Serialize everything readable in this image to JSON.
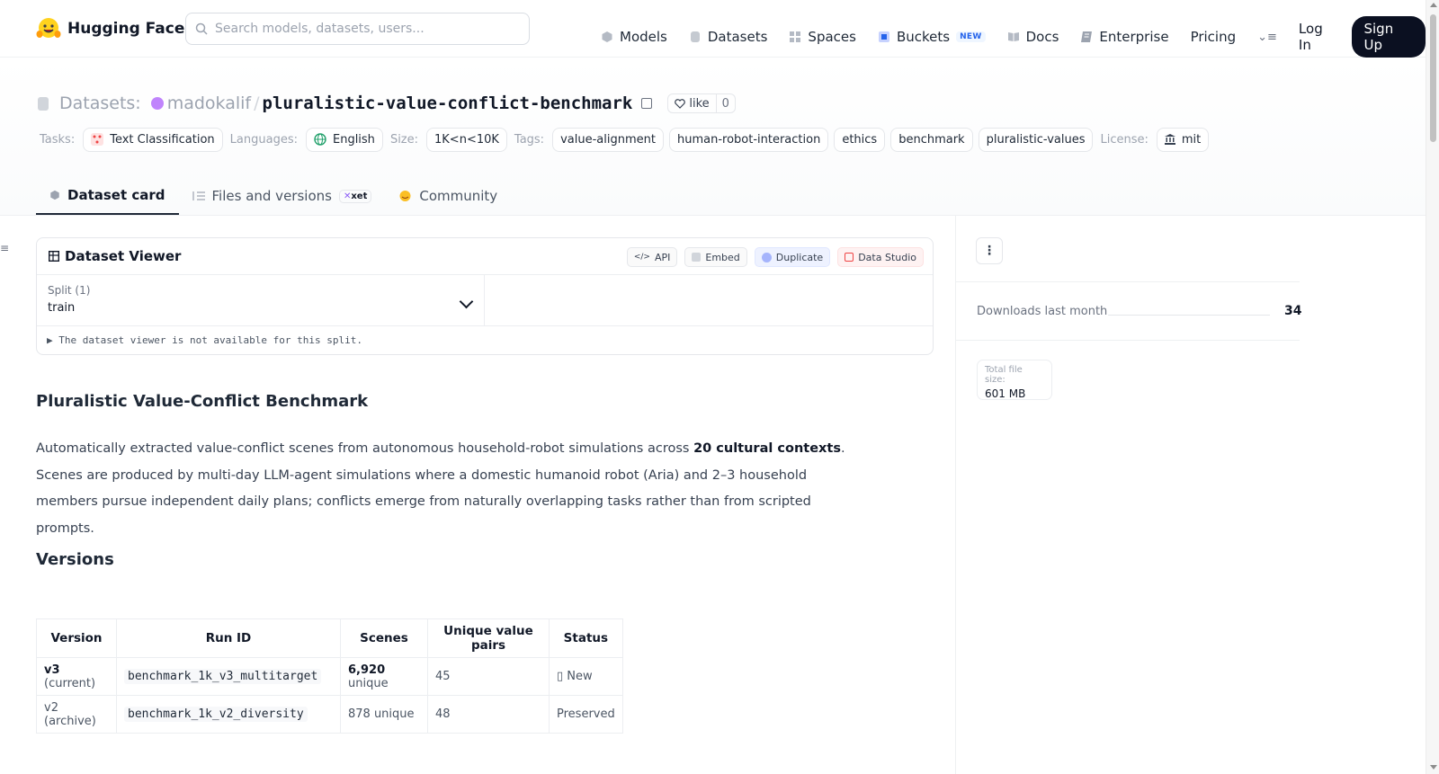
{
  "brand": {
    "name": "Hugging Face"
  },
  "search": {
    "placeholder": "Search models, datasets, users..."
  },
  "nav": {
    "models": "Models",
    "datasets": "Datasets",
    "spaces": "Spaces",
    "buckets": "Buckets",
    "buckets_badge": "NEW",
    "docs": "Docs",
    "enterprise": "Enterprise",
    "pricing": "Pricing",
    "login": "Log In",
    "signup": "Sign Up"
  },
  "repo": {
    "type_label": "Datasets:",
    "org": "madokalif",
    "separator": "/",
    "name": "pluralistic-value-conflict-benchmark",
    "like_label": "like",
    "like_count": "0"
  },
  "meta": {
    "tasks_label": "Tasks:",
    "task": "Text Classification",
    "languages_label": "Languages:",
    "language": "English",
    "size_label": "Size:",
    "size": "1K<n<10K",
    "tags_label": "Tags:",
    "tags": [
      "value-alignment",
      "human-robot-interaction",
      "ethics",
      "benchmark",
      "pluralistic-values"
    ],
    "license_label": "License:",
    "license": "mit"
  },
  "tabs": {
    "dataset_card": "Dataset card",
    "files": "Files and versions",
    "files_badge": "xet",
    "community": "Community"
  },
  "viewer": {
    "title": "Dataset Viewer",
    "actions": {
      "api": "API",
      "embed": "Embed",
      "duplicate": "Duplicate",
      "data_studio": "Data Studio"
    },
    "split_label": "Split (1)",
    "split_value": "train",
    "not_available": "The dataset viewer is not available for this split."
  },
  "content": {
    "heading": "Pluralistic Value-Conflict Benchmark",
    "para_part1": "Automatically extracted value-conflict scenes from autonomous household-robot simulations across ",
    "para_bold": "20 cultural contexts",
    "para_part2": ". Scenes are produced by multi-day LLM-agent simulations where a domestic humanoid robot (Aria) and 2–3 household members pursue independent daily plans; conflicts emerge from naturally overlapping tasks rather than from scripted prompts.",
    "versions_heading": "Versions"
  },
  "versions_table": {
    "headers": [
      "Version",
      "Run ID",
      "Scenes",
      "Unique value pairs",
      "Status"
    ],
    "rows": [
      {
        "version_bold": "v3",
        "version_rest": " (current)",
        "run_id": "benchmark_1k_v3_multitarget",
        "scenes_bold": "6,920",
        "scenes_rest": " unique",
        "pairs": "45",
        "status": "▯ New"
      },
      {
        "version_bold": "",
        "version_rest": "v2 (archive)",
        "run_id": "benchmark_1k_v2_diversity",
        "scenes_bold": "",
        "scenes_rest": "878 unique",
        "pairs": "48",
        "status": "Preserved"
      }
    ]
  },
  "sidebar": {
    "downloads_label": "Downloads last month",
    "downloads_value": "34",
    "file_size_label": "Total file size:",
    "file_size_value": "601 MB"
  },
  "icons": {
    "search": "search-icon",
    "models": "cube-icon",
    "datasets": "database-icon",
    "spaces": "grid-icon",
    "buckets": "bucket-icon",
    "docs": "book-icon",
    "enterprise": "enterprise-icon",
    "menu": "menu-icon"
  },
  "colors": {
    "accent": "#0b1021",
    "org": "#c084fc",
    "new_badge": "#2563eb"
  }
}
